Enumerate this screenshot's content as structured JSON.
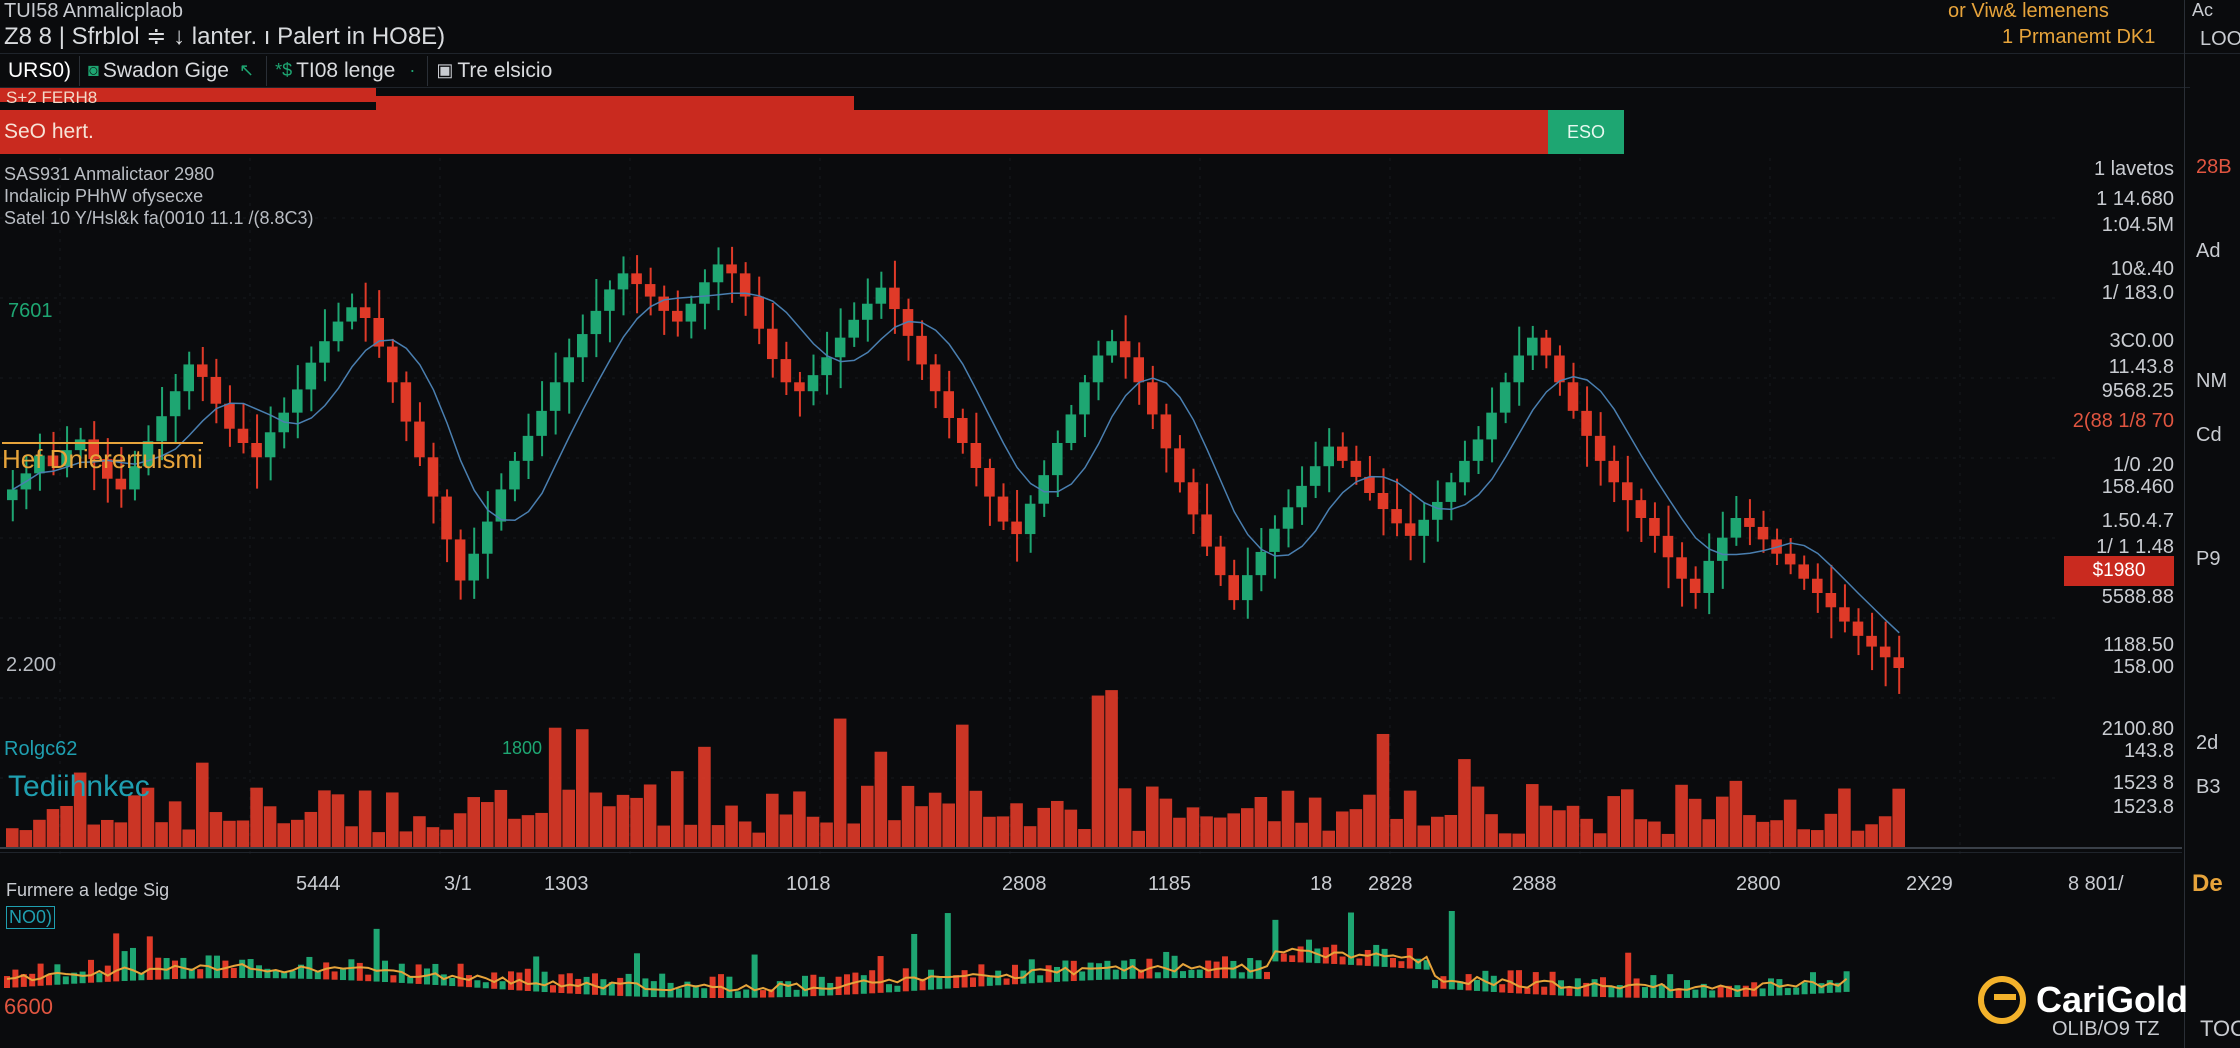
{
  "header": {
    "title": "TUI58 Anmalicplaob",
    "subtitle": "Z8 8 | Sfrblol ≑ ↓ lanter. ı Palert in HO8E)",
    "right_1": "or Viw& lemenens",
    "right_2": "1 Prmanemt DK1",
    "far_1": "Ac",
    "far_2": "LOO"
  },
  "toolbar": {
    "symbol": "URS0)",
    "items": [
      "Swadon Gige",
      "TI08 lenge",
      "Tre elsicio"
    ]
  },
  "banner": {
    "top_label": "S+2 FERH8",
    "label": "SeO hert.",
    "green_tag": "ESO"
  },
  "chart_info": {
    "line1": "SAS931 Anmalictaor 2980",
    "line2": "Indalicip PHhW ofysecxe",
    "line3": "Satel 10 Y/Hsl&k fa(0010 11.1 /(8.8C3)"
  },
  "labels": {
    "green": "7601",
    "yellow": "Hef Dnierertulsmi",
    "gray": "2.200",
    "teal_1": "Rolgc62",
    "teal_2": "Tediihnkec",
    "mid": "1800"
  },
  "price_axis": [
    "1 lavetos",
    "1 14.680",
    "1:04.5M",
    "10&.40",
    "1/ 183.0",
    "3C0.00",
    "11.43.8",
    "9568.25",
    "2(88 1/8 70",
    "1/0 .20",
    "158.460",
    "1.50.4.7",
    "1/ 1 1.48",
    "5588.88",
    "1188.50",
    "158.00",
    "2100.80",
    "143.8",
    "1523 8",
    "1523.8"
  ],
  "price_tag": "$1980",
  "side_col": [
    "28B",
    "Ad",
    "NM",
    "Cd",
    "P9",
    "2d",
    "B3"
  ],
  "x_axis": [
    "5444",
    "3/1",
    "1303",
    "1018",
    "2808",
    "1185",
    "18",
    "2828",
    "2888",
    "2800",
    "2X29",
    "8 801/"
  ],
  "indicator": {
    "label": "Furmere a ledge Sig",
    "sub": "NO0)",
    "bottom": "6600"
  },
  "brand": {
    "name": "CariGold",
    "sub": "OLIB/O9 TZ",
    "far_1": "De",
    "far_2": "TOO"
  },
  "colors": {
    "up": "#1ea672",
    "down": "#e03a28",
    "volume": "#e03a28",
    "accent": "#e7a43b",
    "teal": "#1f9fb0"
  },
  "chart_data": {
    "type": "candlestick",
    "closes": [
      2188,
      2197,
      2207,
      2201,
      2210,
      2216,
      2205,
      2194,
      2188,
      2201,
      2215,
      2229,
      2243,
      2258,
      2251,
      2236,
      2222,
      2214,
      2206,
      2220,
      2231,
      2244,
      2259,
      2271,
      2282,
      2290,
      2284,
      2268,
      2248,
      2226,
      2206,
      2184,
      2160,
      2137,
      2152,
      2170,
      2188,
      2204,
      2218,
      2232,
      2248,
      2262,
      2275,
      2288,
      2300,
      2309,
      2303,
      2296,
      2288,
      2282,
      2292,
      2304,
      2314,
      2309,
      2296,
      2278,
      2261,
      2248,
      2243,
      2252,
      2262,
      2273,
      2283,
      2292,
      2301,
      2289,
      2274,
      2258,
      2243,
      2228,
      2214,
      2200,
      2184,
      2170,
      2163,
      2180,
      2196,
      2214,
      2230,
      2248,
      2263,
      2271,
      2262,
      2248,
      2230,
      2211,
      2192,
      2174,
      2156,
      2140,
      2126,
      2140,
      2153,
      2166,
      2178,
      2190,
      2201,
      2212,
      2204,
      2195,
      2186,
      2177,
      2169,
      2162,
      2171,
      2181,
      2192,
      2204,
      2216,
      2231,
      2248,
      2263,
      2273,
      2263,
      2248,
      2232,
      2218,
      2204,
      2192,
      2182,
      2172,
      2162,
      2150,
      2138,
      2130,
      2148,
      2161,
      2172,
      2167,
      2160,
      2152,
      2146,
      2138,
      2130,
      2122,
      2114,
      2106,
      2100,
      2094,
      2088
    ]
  }
}
